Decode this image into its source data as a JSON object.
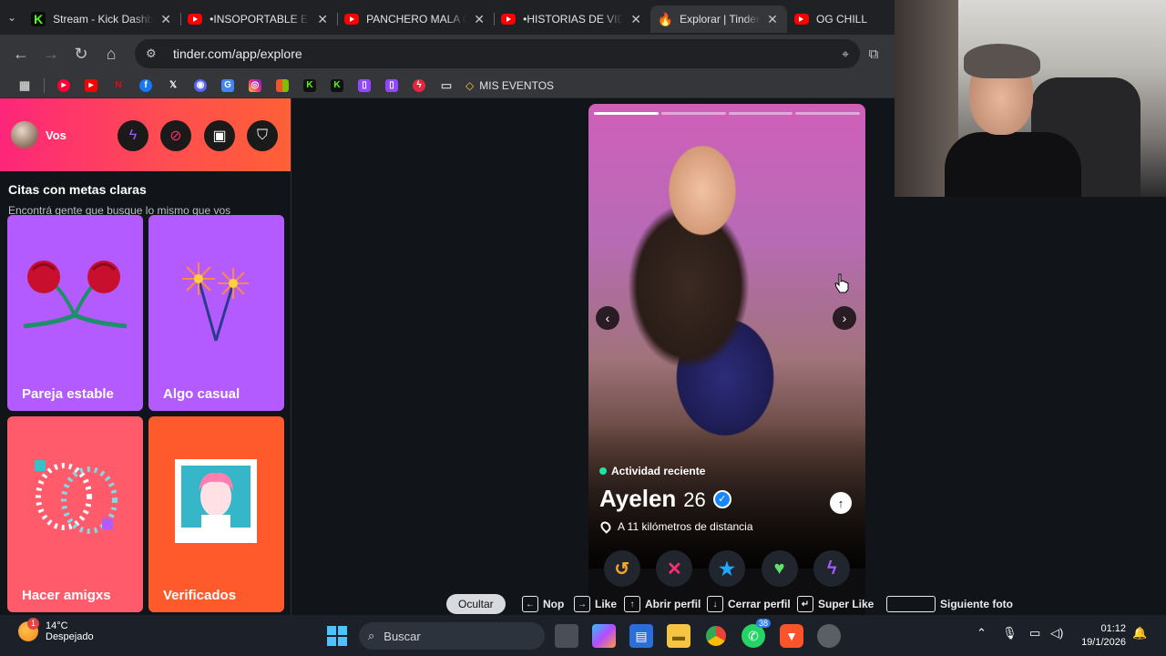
{
  "tabs": [
    {
      "title": "Stream - Kick Dashboard",
      "favicon": "kick-icon",
      "active": false
    },
    {
      "title": "•INSOPORTABLE EN L",
      "favicon": "youtube-icon",
      "active": false
    },
    {
      "title": "PANCHERO MALA ONDA",
      "favicon": "youtube-icon",
      "active": false
    },
    {
      "title": "•HISTORIAS DE VIDA",
      "favicon": "youtube-icon",
      "active": false
    },
    {
      "title": "Explorar | Tinder",
      "favicon": "tinder-icon",
      "active": true
    },
    {
      "title": "OG CHILL",
      "favicon": "youtube-icon",
      "active": false
    }
  ],
  "address": {
    "url": "tinder.com/app/explore"
  },
  "bookmarks": {
    "folder_label": "MIS EVENTOS"
  },
  "sidebar": {
    "user_label": "Vos",
    "section_title": "Citas con metas claras",
    "section_subtitle": "Encontrá gente que busque lo mismo que vos",
    "cards": [
      {
        "label": "Pareja estable",
        "color": "#b35bff"
      },
      {
        "label": "Algo casual",
        "color": "#b35bff"
      },
      {
        "label": "Hacer amigxs",
        "color": "#ff5b6b"
      },
      {
        "label": "Verificados",
        "color": "#ff5a2b"
      }
    ]
  },
  "profile": {
    "activity": "Actividad reciente",
    "name": "Ayelen",
    "age": "26",
    "distance": "A 11 kilómetros de distancia",
    "photo_count": 4,
    "current_photo": 1
  },
  "hints": {
    "hide": "Ocultar",
    "nope": "Nop",
    "like": "Like",
    "open": "Abrir perfil",
    "close": "Cerrar perfil",
    "superlike": "Super Like",
    "next_photo": "Siguiente foto"
  },
  "taskbar": {
    "temperature": "14°C",
    "weather": "Despejado",
    "search": "Buscar",
    "whatsapp_badge": "38",
    "time": "01:12",
    "date": "19/1/2026",
    "weather_alert": "1"
  },
  "colors": {
    "tinder_pink": "#fd267a",
    "tinder_orange": "#ff6036",
    "active_dot": "#1ee3a1",
    "verified_blue": "#1786ff"
  }
}
